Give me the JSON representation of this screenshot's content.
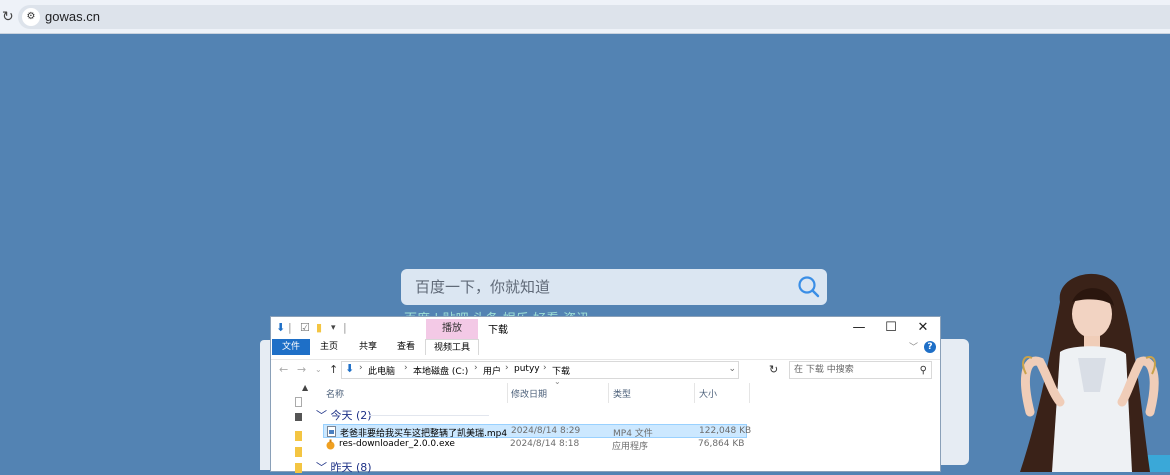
{
  "browser": {
    "url": "gowas.cn"
  },
  "baidu": {
    "search_placeholder": "百度一下，你就知道",
    "hot_links": "百度 | 贴吧  头条  娱乐  好看  资讯"
  },
  "explorer": {
    "title": "下载",
    "context_tab": "播放",
    "ribbon_tabs": [
      "文件",
      "主页",
      "共享",
      "查看",
      "视频工具"
    ],
    "breadcrumb": [
      "此电脑",
      "本地磁盘 (C:)",
      "用户",
      "putyy",
      "下载"
    ],
    "search_placeholder": "在 下载 中搜索",
    "columns": [
      "名称",
      "修改日期",
      "类型",
      "大小"
    ],
    "groups": [
      {
        "label": "今天 (2)",
        "files": [
          {
            "name": "老爸非要给我买车这把整辆了凯美瑞.mp4",
            "date": "2024/8/14 8:29",
            "type": "MP4 文件",
            "size": "122,048 KB",
            "selected": true
          },
          {
            "name": "res-downloader_2.0.0.exe",
            "date": "2024/8/14 8:18",
            "type": "应用程序",
            "size": "76,864 KB",
            "selected": false
          }
        ]
      },
      {
        "label": "昨天 (8)",
        "files": []
      }
    ]
  },
  "colors": {
    "page_bg": "#5383b3",
    "selection": "#cce8ff",
    "ribbon_file": "#1e6fc7",
    "context_tab": "#f3c9e6",
    "annotation_arrow": "#e02020"
  }
}
